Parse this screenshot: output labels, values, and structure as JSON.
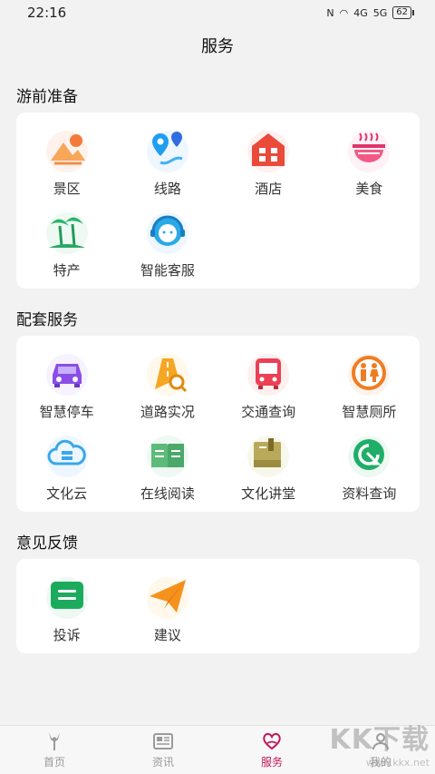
{
  "status": {
    "time": "22:16",
    "signal1": "4G",
    "signal2": "5G",
    "battery": "62"
  },
  "header": {
    "title": "服务"
  },
  "sections": [
    {
      "title": "游前准备",
      "items": [
        {
          "label": "景区",
          "icon": "mountain-icon"
        },
        {
          "label": "线路",
          "icon": "route-pin-icon"
        },
        {
          "label": "酒店",
          "icon": "hotel-icon"
        },
        {
          "label": "美食",
          "icon": "food-bowl-icon"
        },
        {
          "label": "特产",
          "icon": "palm-tree-icon"
        },
        {
          "label": "智能客服",
          "icon": "headset-icon"
        }
      ]
    },
    {
      "title": "配套服务",
      "items": [
        {
          "label": "智慧停车",
          "icon": "car-icon"
        },
        {
          "label": "道路实况",
          "icon": "road-search-icon"
        },
        {
          "label": "交通查询",
          "icon": "bus-icon"
        },
        {
          "label": "智慧厕所",
          "icon": "restroom-icon"
        },
        {
          "label": "文化云",
          "icon": "cloud-server-icon"
        },
        {
          "label": "在线阅读",
          "icon": "open-book-icon"
        },
        {
          "label": "文化讲堂",
          "icon": "books-stack-icon"
        },
        {
          "label": "资料查询",
          "icon": "refresh-search-icon"
        }
      ]
    },
    {
      "title": "意见反馈",
      "items": [
        {
          "label": "投诉",
          "icon": "message-icon"
        },
        {
          "label": "建议",
          "icon": "paper-plane-icon"
        }
      ]
    }
  ],
  "tabs": [
    {
      "label": "首页",
      "icon": "home-deer-icon"
    },
    {
      "label": "资讯",
      "icon": "news-icon"
    },
    {
      "label": "服务",
      "icon": "service-heart-icon"
    },
    {
      "label": "我的",
      "icon": "profile-icon"
    }
  ],
  "watermark": {
    "text": "KK下载",
    "sub": "www.kkx.net"
  },
  "colors": {
    "active_tab": "#c2185b",
    "page_bg": "#f2f2f2",
    "card_bg": "#ffffff"
  }
}
